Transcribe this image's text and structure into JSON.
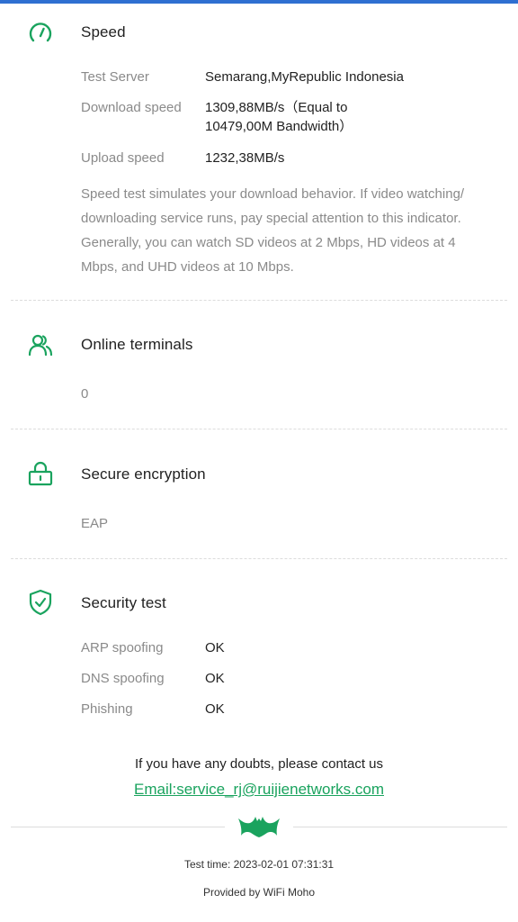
{
  "colors": {
    "accent": "#1aa35e",
    "topbar": "#2f6fd1",
    "muted": "#8a8a8a"
  },
  "speed": {
    "icon": "speedometer-icon",
    "title": "Speed",
    "rows": [
      {
        "label": "Test Server",
        "value": "Semarang,MyRepublic Indonesia"
      },
      {
        "label": "Download speed",
        "value": "1309,88MB/s（Equal to 10479,00M Bandwidth）"
      },
      {
        "label": "Upload speed",
        "value": "1232,38MB/s"
      }
    ],
    "note": "Speed test simulates your download behavior. If video watching/ downloading service runs, pay special attention to this indicator. Generally, you can watch SD videos at 2 Mbps, HD videos at 4 Mbps, and UHD videos at 10 Mbps."
  },
  "terminals": {
    "icon": "users-icon",
    "title": "Online terminals",
    "value": "0"
  },
  "encryption": {
    "icon": "lock-icon",
    "title": "Secure encryption",
    "value": "EAP"
  },
  "security": {
    "icon": "shield-check-icon",
    "title": "Security test",
    "rows": [
      {
        "label": "ARP spoofing",
        "value": "OK"
      },
      {
        "label": "DNS spoofing",
        "value": "OK"
      },
      {
        "label": "Phishing",
        "value": "OK"
      }
    ]
  },
  "footer": {
    "contact_text": "If you have any doubts, please contact us",
    "email": "Email:service_rj@ruijienetworks.com",
    "logo_icon": "bat-logo-icon",
    "test_time": "Test time: 2023-02-01 07:31:31",
    "provided_by": "Provided by WiFi Moho"
  }
}
